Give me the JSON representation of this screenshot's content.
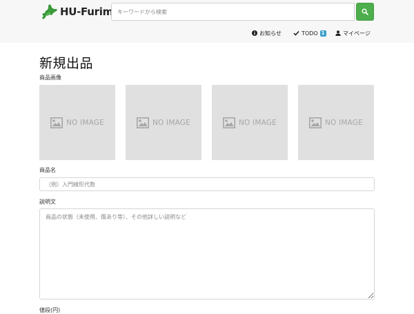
{
  "header": {
    "logo_text": "HU-Furima",
    "search": {
      "placeholder": "キーワードから検索",
      "value": ""
    },
    "nav": {
      "notices_label": "お知らせ",
      "todo_label": "TODO",
      "todo_count": "1",
      "mypage_label": "マイページ"
    }
  },
  "page": {
    "title": "新規出品",
    "image_label": "商品画像",
    "image_slots": [
      {
        "text": "NO IMAGE"
      },
      {
        "text": "NO IMAGE"
      },
      {
        "text": "NO IMAGE"
      },
      {
        "text": "NO IMAGE"
      }
    ],
    "name_label": "商品名",
    "name_placeholder": "（例）入門線形代数",
    "description_label": "説明文",
    "description_placeholder": "商品の状態（未使用、傷あり等）、その他詳しい説明など",
    "price_label": "値段(円)"
  },
  "colors": {
    "search_button": "#4cae4c",
    "badge": "#3a9ec9",
    "placeholder_bg": "#e0e0e0"
  },
  "icons": {
    "logo": "hokkaido-map-icon",
    "search": "search-icon",
    "notices": "info-circle-icon",
    "todo": "check-icon",
    "mypage": "user-icon",
    "image_placeholder": "picture-icon"
  }
}
